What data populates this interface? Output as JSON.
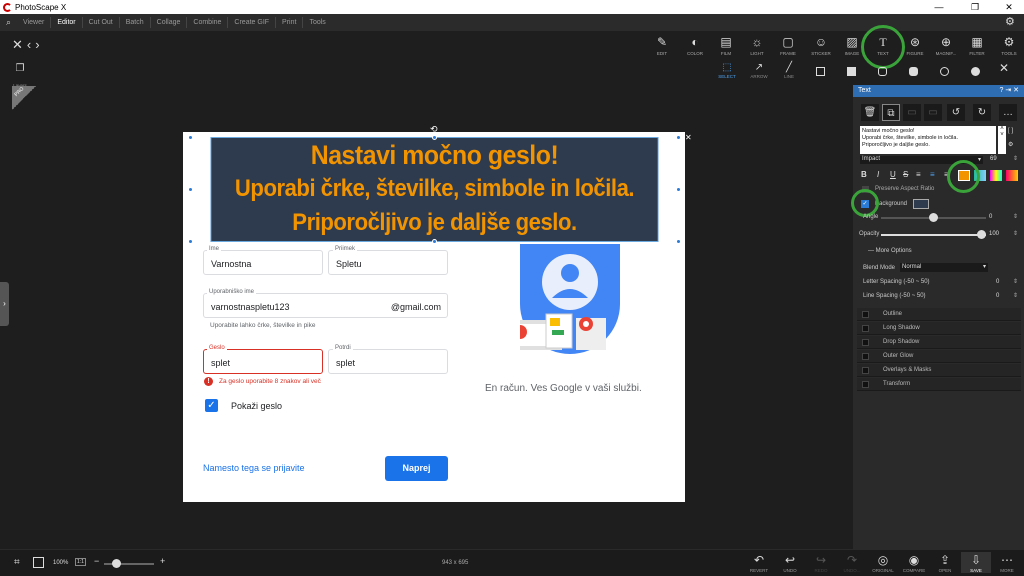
{
  "window": {
    "title": "PhotoScape X",
    "min": "—",
    "max": "❐",
    "close": "✕"
  },
  "menu": [
    "Viewer",
    "Editor",
    "Cut Out",
    "Batch",
    "Collage",
    "Combine",
    "Create GIF",
    "Print",
    "Tools"
  ],
  "active_menu": "Editor",
  "toolbar": [
    {
      "label": "EDIT",
      "icon": "✎"
    },
    {
      "label": "COLOR",
      "icon": "◐"
    },
    {
      "label": "FILM",
      "icon": "▤"
    },
    {
      "label": "LIGHT",
      "icon": "☼"
    },
    {
      "label": "FRAME",
      "icon": "▢"
    },
    {
      "label": "STICKER",
      "icon": "☺"
    },
    {
      "label": "IMAGE",
      "icon": "▨"
    },
    {
      "label": "TEXT",
      "icon": "T"
    },
    {
      "label": "FIGURE",
      "icon": "⊛"
    },
    {
      "label": "MAGNIF...",
      "icon": "⊕"
    },
    {
      "label": "FILTER",
      "icon": "▦"
    },
    {
      "label": "TOOLS",
      "icon": "⚙"
    }
  ],
  "subtools": [
    {
      "label": "SELECT",
      "icon": "⬚"
    },
    {
      "label": "ARROW",
      "icon": "↗"
    },
    {
      "label": "LINE",
      "icon": "╱"
    }
  ],
  "left": {
    "layers_label": "Layers",
    "pro": "PRO"
  },
  "doc": {
    "ime_label": "Ime",
    "ime_value": "Varnostna",
    "priimek_label": "Priimek",
    "priimek_value": "Spletu",
    "user_label": "Uporabniško ime",
    "user_value": "varnostnaspletu123",
    "user_suffix": "@gmail.com",
    "user_hint": "Uporabite lahko črke, številke in pike",
    "geslo_label": "Geslo",
    "geslo_value": "splet",
    "potrdi_label": "Potrdi",
    "potrdi_value": "splet",
    "error": "Za geslo uporabite 8 znakov ali več",
    "show_pw": "Pokaži geslo",
    "signin_link": "Namesto tega se prijavite",
    "next": "Naprej",
    "tagline": "En račun. Ves Google v vaši službi."
  },
  "overlay": {
    "line1": "Nastavi močno geslo!",
    "line2": "Uporabi črke, številke, simbole in ločila.",
    "line3": "Priporočljivo je daljše geslo."
  },
  "panel": {
    "title": "Text",
    "text_value": "Nastavi močno geslo!\nUporabi črke, številke, simbole in ločila.\nPriporočljivo je daljše geslo.",
    "font": "Impact",
    "font_size": "69",
    "format": [
      "B",
      "I",
      "U",
      "S"
    ],
    "text_color": "#f29400",
    "preserve": "Preserve Aspect Ratio",
    "background": "Background",
    "bg_color": "#2e3a4e",
    "angle_label": "Angle",
    "angle_value": "0",
    "opacity_label": "Opacity",
    "opacity_value": "100",
    "more_options": "More Options",
    "blend_label": "Blend Mode",
    "blend_value": "Normal",
    "letter_label": "Letter Spacing (-50 ~ 50)",
    "letter_value": "0",
    "linesp_label": "Line Spacing (-50 ~ 50)",
    "linesp_value": "0",
    "effects": [
      "Outline",
      "Long Shadow",
      "Drop Shadow",
      "Outer Glow",
      "Overlays & Masks",
      "Transform"
    ]
  },
  "bottom": {
    "zoom": "100%",
    "ratio": "1:1",
    "dimensions": "943 x 695",
    "buttons": [
      {
        "label": "REVERT",
        "icon": "↶"
      },
      {
        "label": "UNDO",
        "icon": "↩"
      },
      {
        "label": "REDO",
        "icon": "↪"
      },
      {
        "label": "UNDO...",
        "icon": "↷"
      },
      {
        "label": "ORIGINAL",
        "icon": "◎"
      },
      {
        "label": "COMPARE",
        "icon": "◉"
      },
      {
        "label": "OPEN",
        "icon": "⇪"
      },
      {
        "label": "SAVE",
        "icon": "⇩"
      },
      {
        "label": "MORE",
        "icon": "⋯"
      }
    ]
  }
}
